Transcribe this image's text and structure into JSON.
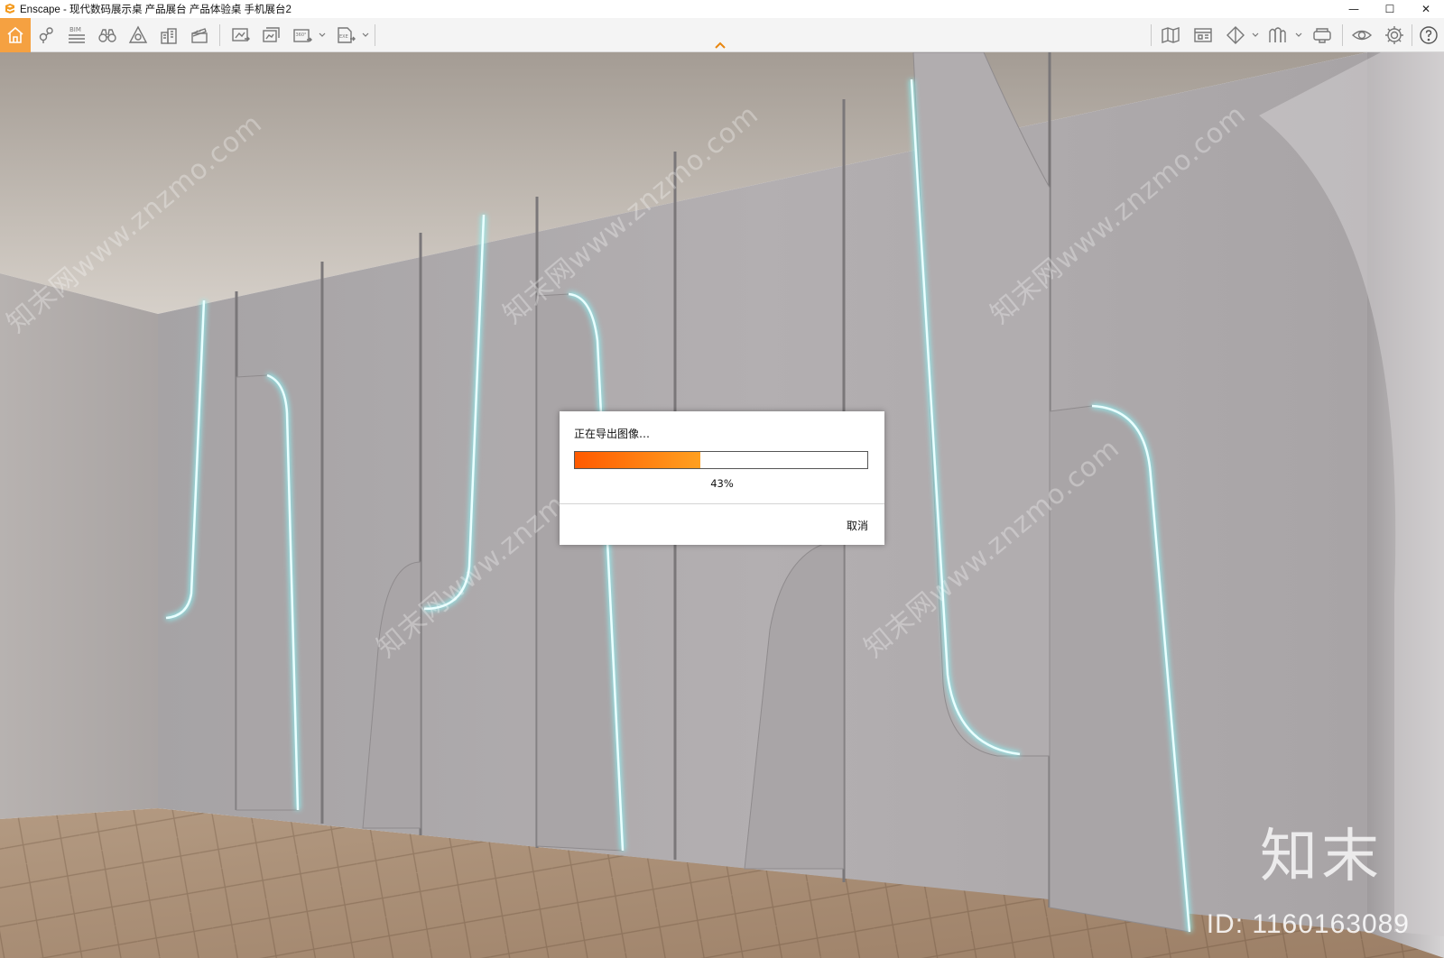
{
  "window": {
    "title": "Enscape - 现代数码展示桌 产品展台 产品体验桌 手机展台2",
    "controls": {
      "minimize": "—",
      "maximize": "☐",
      "close": "✕"
    }
  },
  "toolbar": {
    "items": [
      {
        "name": "home-icon",
        "active": true
      },
      {
        "name": "waypoint-icon"
      },
      {
        "name": "bim-icon",
        "label": "BIM"
      },
      {
        "name": "binoculars-icon"
      },
      {
        "name": "asset-library-icon"
      },
      {
        "name": "buildings-icon"
      },
      {
        "name": "clapperboard-icon"
      },
      {
        "name": "screenshot-icon"
      },
      {
        "name": "batch-render-icon"
      },
      {
        "name": "panorama-icon",
        "label": "360°"
      },
      {
        "name": "exe-export-icon",
        "label": "EXE"
      },
      {
        "name": "map-icon"
      },
      {
        "name": "views-icon"
      },
      {
        "name": "section-icon"
      },
      {
        "name": "materials-icon"
      },
      {
        "name": "vr-headset-icon"
      },
      {
        "name": "visual-settings-icon"
      },
      {
        "name": "settings-icon"
      },
      {
        "name": "help-icon"
      }
    ],
    "accent_color": "#f5a141"
  },
  "dialog": {
    "title": "正在导出图像…",
    "progress_percent": 43,
    "progress_label": "43%",
    "cancel_label": "取消",
    "progress_colors": [
      "#ff5a00",
      "#ffa020"
    ]
  },
  "watermark": {
    "diagonal_text": "知末网www.znzmo.com",
    "brand": "知末",
    "id_label": "ID: 1160163089"
  }
}
